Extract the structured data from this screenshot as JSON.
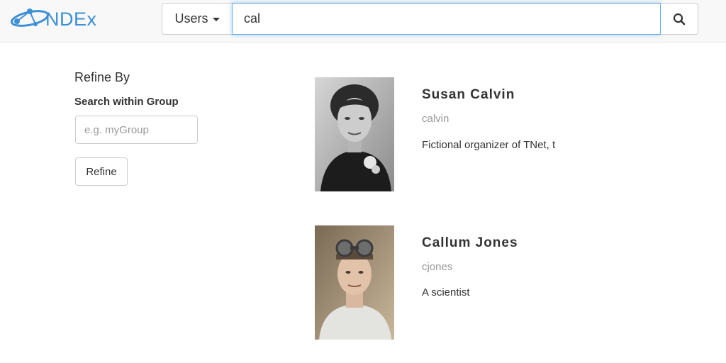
{
  "header": {
    "logo_text": "NDEx",
    "search_type": "Users",
    "search_query": "cal"
  },
  "sidebar": {
    "title": "Refine By",
    "label": "Search within Group",
    "group_placeholder": "e.g. myGroup",
    "refine_button": "Refine"
  },
  "results": [
    {
      "name": "Susan Calvin",
      "username": "calvin",
      "description": "Fictional organizer of TNet, t"
    },
    {
      "name": "Callum Jones",
      "username": "cjones",
      "description": "A scientist"
    }
  ],
  "colors": {
    "brand": "#3d8fd6",
    "header_bg": "#f8f8f8",
    "focus_border": "#66afe9"
  }
}
